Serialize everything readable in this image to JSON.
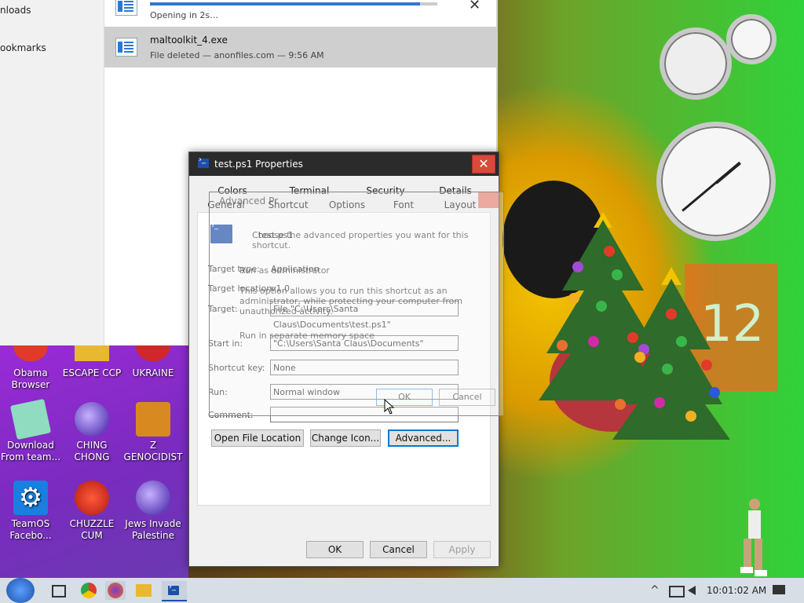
{
  "browser": {
    "sidebar": [
      "nloads",
      "ookmarks"
    ],
    "downloads": [
      {
        "title": "",
        "subtitle": "Opening in 2s…",
        "progress": 0.94
      },
      {
        "title": "maltoolkit_4.exe",
        "subtitle": "File deleted — anonfiles.com — 9:56 AM"
      }
    ],
    "close_glyph": "✕"
  },
  "desktop_icons": [
    {
      "label_1": "Obama",
      "label_2": "Browser"
    },
    {
      "label_1": "ESCAPE CCP",
      "label_2": ""
    },
    {
      "label_1": "UKRAINE",
      "label_2": ""
    },
    {
      "label_1": "Download",
      "label_2": "From team..."
    },
    {
      "label_1": "CHING",
      "label_2": "CHONG"
    },
    {
      "label_1": "Z",
      "label_2": "GENOCIDIST"
    },
    {
      "label_1": "TeamOS",
      "label_2": "Facebo..."
    },
    {
      "label_1": "CHUZZLE",
      "label_2": "CUM"
    },
    {
      "label_1": "Jews Invade",
      "label_2": "Palestine"
    }
  ],
  "calendar": {
    "day": "12"
  },
  "dialog": {
    "title": "test.ps1 Properties",
    "close_glyph": "✕",
    "tabs_row1": [
      "Colors",
      "Terminal",
      "Security",
      "Details"
    ],
    "tabs_row2": [
      "General",
      "Shortcut",
      "Options",
      "Font",
      "Layout"
    ],
    "file_name": "test.ps1",
    "fields": {
      "target_type_label": "Target type:",
      "target_type_value": "Application",
      "target_location_label": "Target location:",
      "target_location_value": "v1.0",
      "target_label": "Target:",
      "target_value": "File \"C:\\Users\\Santa Claus\\Documents\\test.ps1\"",
      "start_in_label": "Start in:",
      "start_in_value": "\"C:\\Users\\Santa Claus\\Documents\"",
      "shortcut_key_label": "Shortcut key:",
      "shortcut_key_value": "None",
      "run_label": "Run:",
      "run_value": "Normal window",
      "comment_label": "Comment:",
      "comment_value": ""
    },
    "buttons": {
      "open_file_location": "Open File Location",
      "change_icon": "Change Icon...",
      "advanced": "Advanced...",
      "ok": "OK",
      "cancel": "Cancel",
      "apply": "Apply"
    },
    "ghost_advanced": {
      "title": "Advanced Pr",
      "instruction": "Choose the advanced properties you want for this shortcut.",
      "run_as_admin": "Run as administrator",
      "desc_1": "This option allows you to run this shortcut as an",
      "desc_2": "administrator, while protecting your computer from",
      "desc_3": "unauthorized activity.",
      "separate_memory": "Run in separate memory space",
      "ok": "OK",
      "cancel": "Cancel"
    }
  },
  "taskbar": {
    "time": "10:01:02 AM",
    "tray_chevron": "^"
  },
  "colors": {
    "accent": "#0078d7",
    "dialog_title_bg": "#2b2b2b",
    "close_red": "#d94a3a",
    "progress": "#2b78d6"
  }
}
